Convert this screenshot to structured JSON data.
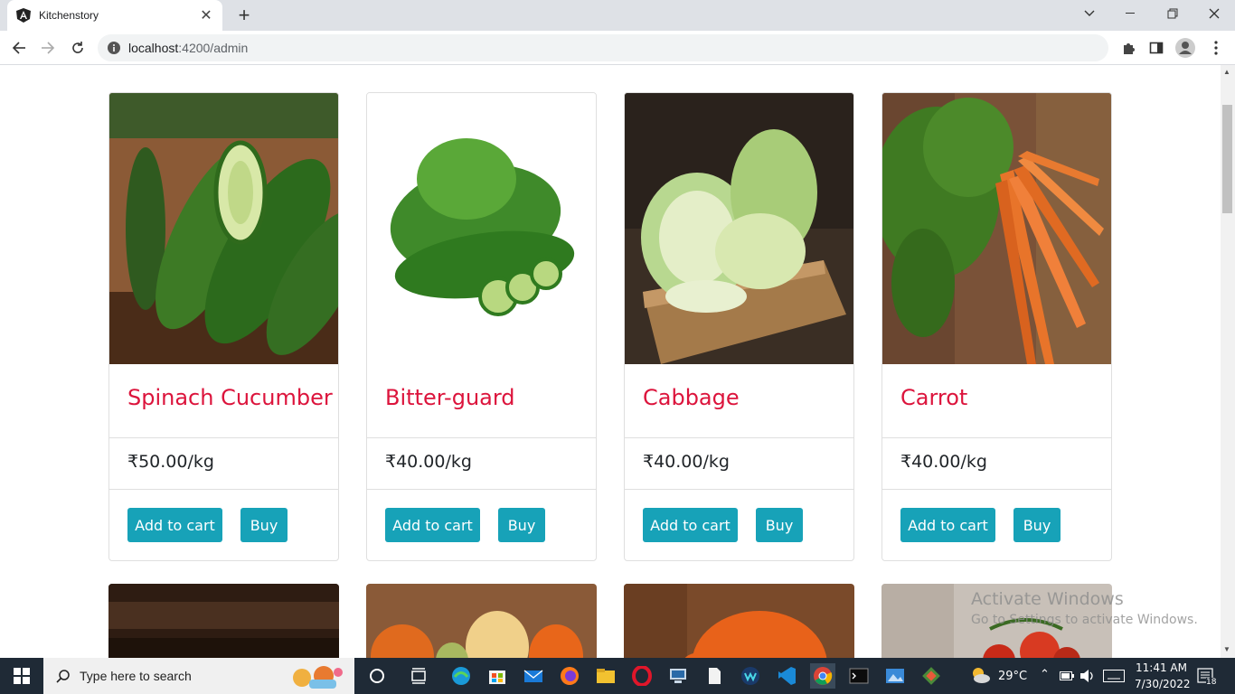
{
  "browser": {
    "tab_title": "Kitchenstory",
    "url_host": "localhost",
    "url_path": ":4200/admin"
  },
  "products": [
    {
      "name": "Spinach Cucumber",
      "price": "₹50.00/kg",
      "add_label": "Add to cart",
      "buy_label": "Buy"
    },
    {
      "name": "Bitter-guard",
      "price": "₹40.00/kg",
      "add_label": "Add to cart",
      "buy_label": "Buy"
    },
    {
      "name": "Cabbage",
      "price": "₹40.00/kg",
      "add_label": "Add to cart",
      "buy_label": "Buy"
    },
    {
      "name": "Carrot",
      "price": "₹40.00/kg",
      "add_label": "Add to cart",
      "buy_label": "Buy"
    }
  ],
  "watermark": {
    "line1": "Activate Windows",
    "line2": "Go to Settings to activate Windows."
  },
  "taskbar": {
    "search_placeholder": "Type here to search",
    "weather": "29°C",
    "time": "11:41 AM",
    "date": "7/30/2022",
    "notification_count": "18"
  },
  "colors": {
    "title": "#dc143c",
    "button": "#17a2b8",
    "taskbar": "#1f2a36"
  }
}
